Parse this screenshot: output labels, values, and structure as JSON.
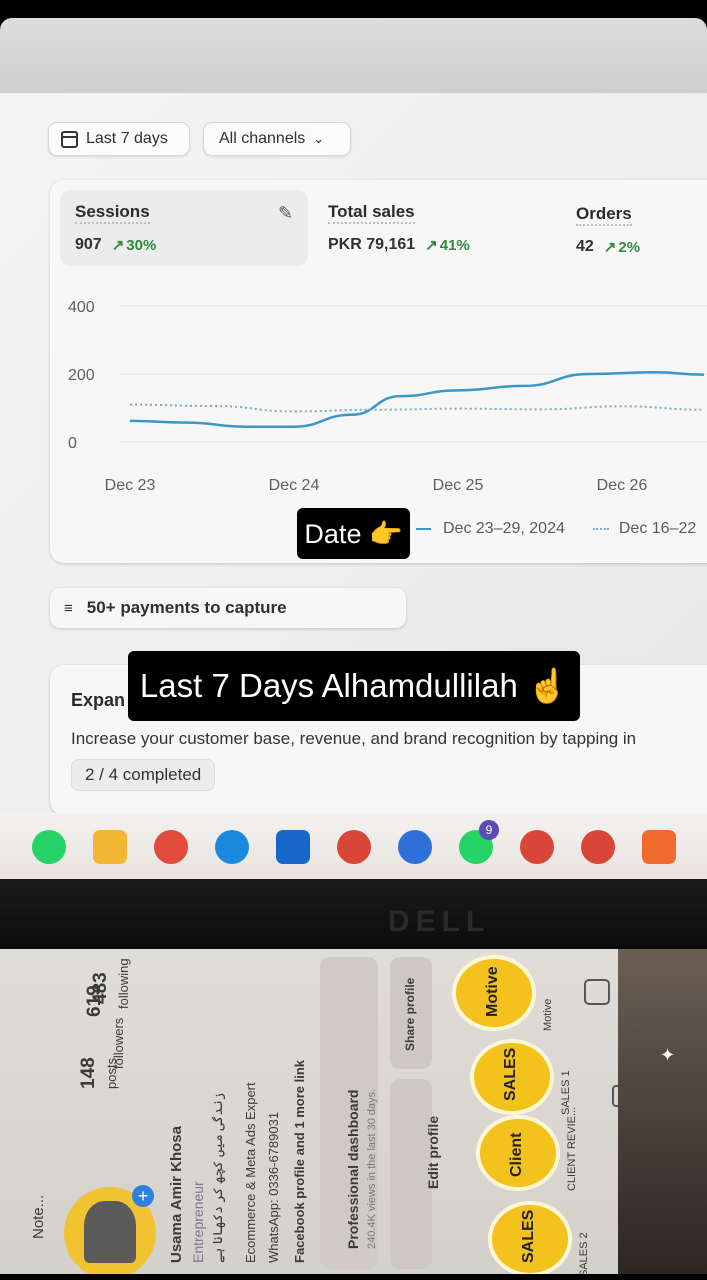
{
  "filters": {
    "date_label": "Last 7 days",
    "channels_label": "All channels"
  },
  "metrics": [
    {
      "label": "Sessions",
      "value": "907",
      "change": "30%"
    },
    {
      "label": "Total sales",
      "value": "PKR 79,161",
      "change": "41%"
    },
    {
      "label": "Orders",
      "value": "42",
      "change": "2%"
    }
  ],
  "chart_data": {
    "type": "line",
    "x": [
      "Dec 23",
      "Dec 24",
      "Dec 25",
      "Dec 26"
    ],
    "yticks": [
      "400",
      "200",
      "0"
    ],
    "ylim": [
      0,
      400
    ],
    "grid": true,
    "legend_position": "bottom-right",
    "series": [
      {
        "name": "Dec 23–29, 2024",
        "style": "solid",
        "color": "#3a97c9",
        "points": [
          [
            0,
            62
          ],
          [
            0.35,
            57
          ],
          [
            0.7,
            45
          ],
          [
            1.0,
            45
          ],
          [
            1.35,
            80
          ],
          [
            1.65,
            135
          ],
          [
            2.0,
            152
          ],
          [
            2.4,
            165
          ],
          [
            2.8,
            200
          ],
          [
            3.2,
            205
          ],
          [
            3.5,
            198
          ]
        ]
      },
      {
        "name": "Dec 16–22",
        "style": "dotted",
        "color": "#7aa9c4",
        "points": [
          [
            0,
            110
          ],
          [
            0.5,
            106
          ],
          [
            1.0,
            90
          ],
          [
            1.5,
            95
          ],
          [
            2.0,
            98
          ],
          [
            2.5,
            96
          ],
          [
            3.0,
            105
          ],
          [
            3.5,
            95
          ]
        ]
      }
    ]
  },
  "overlay_captions": {
    "date_sticker": "Date 👉",
    "main_sticker": "Last 7 Days Alhamdullilah ☝️"
  },
  "payments": {
    "label": "50+ payments to capture"
  },
  "expand_card": {
    "title": "Expan",
    "description": "Increase your customer base, revenue, and brand recognition by tapping in",
    "progress": "2 / 4 completed"
  },
  "taskbar": {
    "apps": [
      {
        "icon": "whatsapp-icon",
        "color": "#25d366"
      },
      {
        "icon": "file-explorer-icon",
        "color": "#f2b632"
      },
      {
        "icon": "chrome-icon",
        "color": "#e04b3c"
      },
      {
        "icon": "edge-icon",
        "color": "#1a8ae0"
      },
      {
        "icon": "store-icon",
        "color": "#1667c9"
      },
      {
        "icon": "chrome-profile-icon",
        "color": "#d94536"
      },
      {
        "icon": "app-icon",
        "color": "#2f6fd9"
      },
      {
        "icon": "whatsapp-icon",
        "color": "#25d366",
        "badge": "9"
      },
      {
        "icon": "chrome-icon",
        "color": "#d94536"
      },
      {
        "icon": "chrome-icon",
        "color": "#d94536"
      },
      {
        "icon": "downloader-icon",
        "color": "#ef6a2c"
      }
    ]
  },
  "laptop_brand": "DELL",
  "instagram": {
    "note": "Note...",
    "stats": [
      {
        "value": "148",
        "label": "posts"
      },
      {
        "value": "619",
        "label": "followers"
      },
      {
        "value": "483",
        "label": "following"
      }
    ],
    "name": "Usama Amir Khosa",
    "category": "Entrepreneur",
    "bio_urdu": "زندگی میں کچھ کر دکھانا ہے",
    "bio_line": "Ecommerce & Meta Ads Expert",
    "whatsapp": "WhatsApp: 0336-6789031",
    "link": "Facebook profile and 1 more link",
    "dashboard_title": "Professional dashboard",
    "dashboard_sub": "240.4K views in the last 30 days.",
    "edit_profile": "Edit profile",
    "share_profile": "Share profile",
    "highlights": [
      {
        "badge": "SALES",
        "label": "SALES 2"
      },
      {
        "badge": "Client",
        "label": "CLIENT REVIE..."
      },
      {
        "badge": "SALES",
        "label": "SALES 1"
      },
      {
        "badge": "Motive",
        "label": "Motive"
      }
    ]
  }
}
